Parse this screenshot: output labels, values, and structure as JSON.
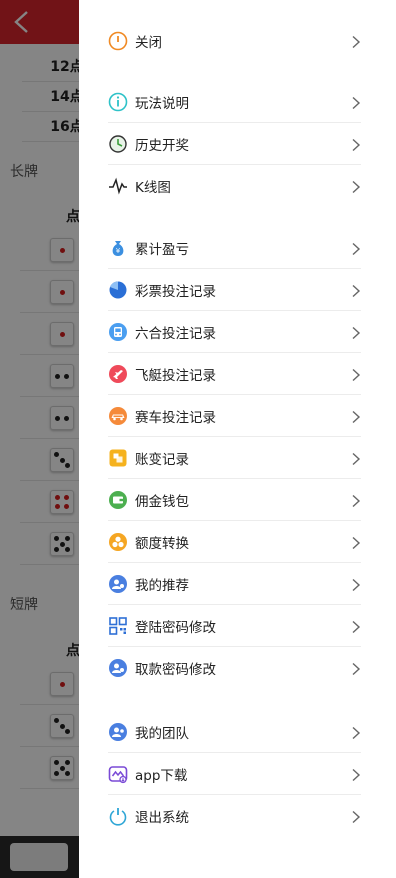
{
  "background": {
    "rows": [
      "12点",
      "14点",
      "16点"
    ],
    "section_long": "长牌",
    "section_short": "短牌",
    "col_head": "点"
  },
  "menu": {
    "items": [
      {
        "label": "关闭",
        "icon": "power-icon",
        "color": "#f08a24"
      },
      {
        "label": "玩法说明",
        "icon": "info-icon",
        "color": "#2ec2c8"
      },
      {
        "label": "历史开奖",
        "icon": "history-clock-icon",
        "color": "#3b9e3b"
      },
      {
        "label": "K线图",
        "icon": "kline-chart-icon",
        "color": "#222222"
      },
      {
        "label": "累计盈亏",
        "icon": "money-bag-icon",
        "color": "#3b8fe0"
      },
      {
        "label": "彩票投注记录",
        "icon": "pie-chart-icon",
        "color": "#2a6fd6"
      },
      {
        "label": "六合投注记录",
        "icon": "bus-icon",
        "color": "#4a9ef0"
      },
      {
        "label": "飞艇投注记录",
        "icon": "airplane-icon",
        "color": "#ef4a5a"
      },
      {
        "label": "赛车投注记录",
        "icon": "race-car-icon",
        "color": "#f58a3a"
      },
      {
        "label": "账变记录",
        "icon": "ledger-icon",
        "color": "#f5b21e"
      },
      {
        "label": "佣金钱包",
        "icon": "wallet-icon",
        "color": "#4caf50"
      },
      {
        "label": "额度转换",
        "icon": "transfer-coins-icon",
        "color": "#f5a623"
      },
      {
        "label": "我的推荐",
        "icon": "recommend-user-icon",
        "color": "#4a7fe0"
      },
      {
        "label": "登陆密码修改",
        "icon": "qr-grid-icon",
        "color": "#2e6fd6"
      },
      {
        "label": "取款密码修改",
        "icon": "withdraw-user-icon",
        "color": "#4a7fe0"
      },
      {
        "label": "我的团队",
        "icon": "team-icon",
        "color": "#4a7fe0"
      },
      {
        "label": "app下载",
        "icon": "app-download-icon",
        "color": "#7a4ad6"
      },
      {
        "label": "退出系统",
        "icon": "logout-power-icon",
        "color": "#2ea6d6"
      }
    ]
  }
}
